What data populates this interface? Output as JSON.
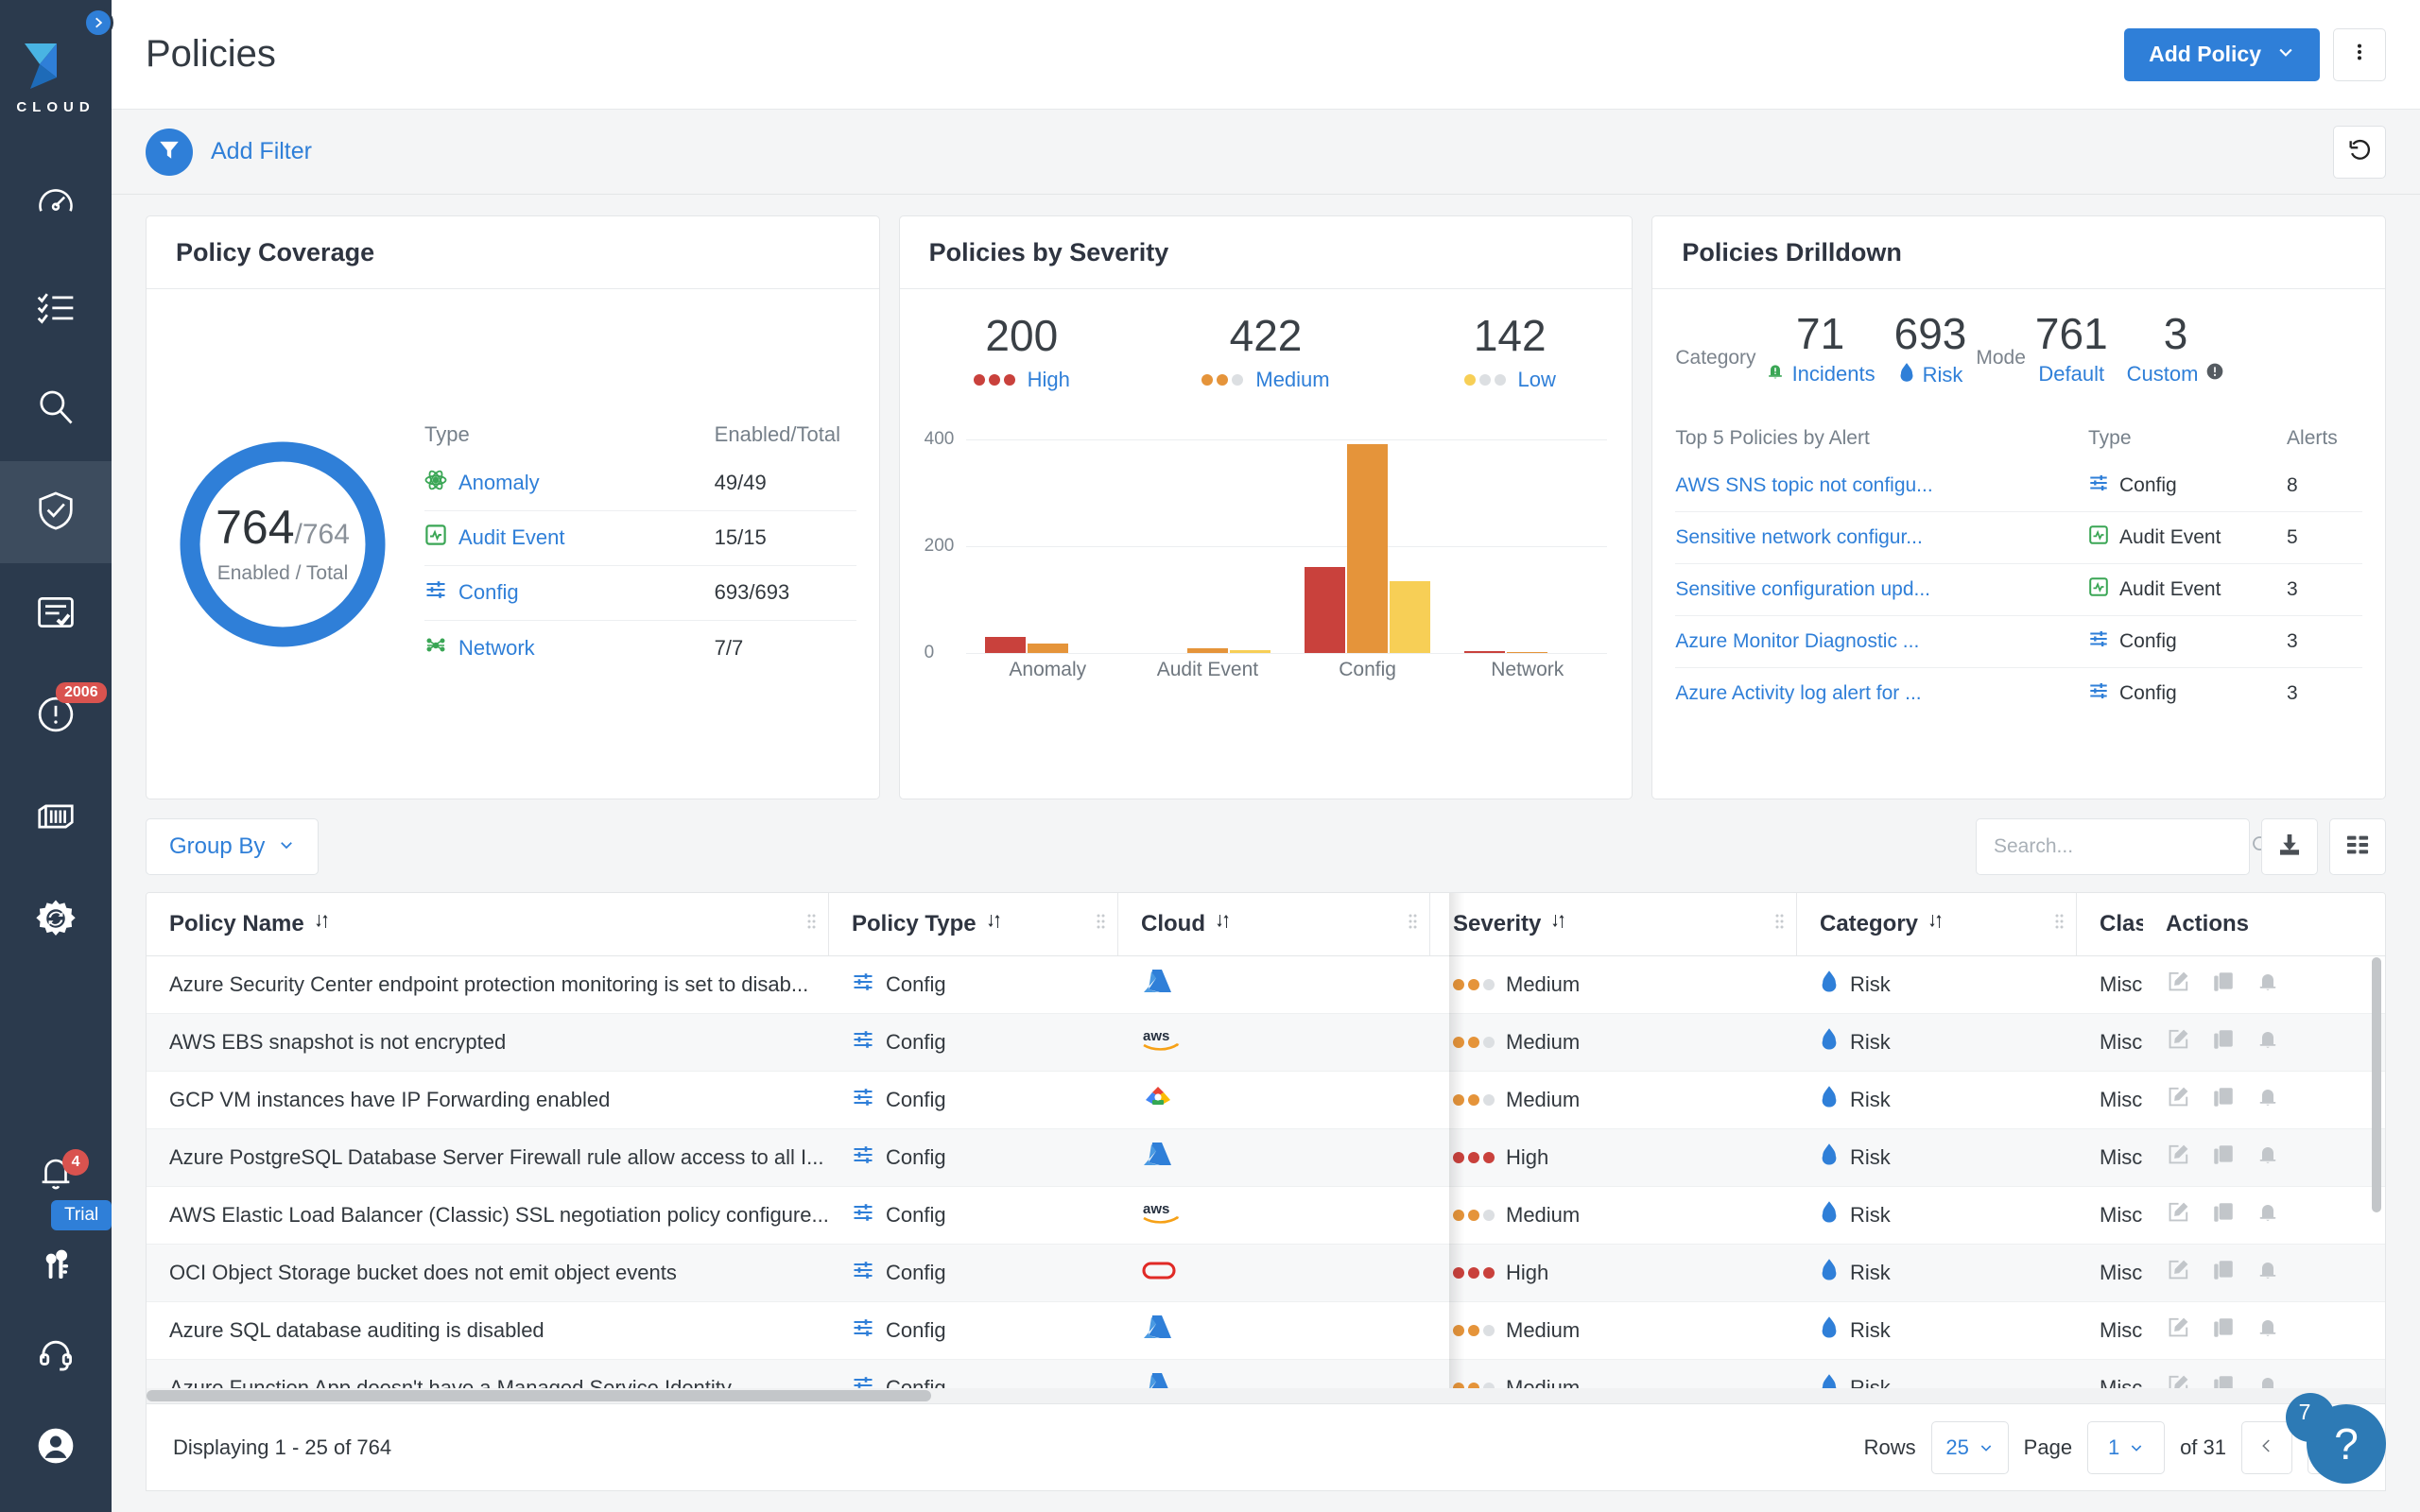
{
  "sidebar": {
    "logo_text": "CLOUD",
    "toggle_icon": "chevron-right-icon",
    "items": [
      {
        "name": "dashboard",
        "icon": "gauge-icon"
      },
      {
        "name": "investigate",
        "icon": "checklist-icon"
      },
      {
        "name": "search",
        "icon": "magnifier-icon"
      },
      {
        "name": "policies",
        "icon": "shield-check-icon",
        "active": true
      },
      {
        "name": "compliance",
        "icon": "document-check-icon"
      },
      {
        "name": "alerts",
        "icon": "exclamation-circle-icon",
        "badge": "2006"
      },
      {
        "name": "containers",
        "icon": "container-icon"
      },
      {
        "name": "settings",
        "icon": "gear-refresh-icon"
      }
    ],
    "bottom_items": [
      {
        "name": "notifications",
        "icon": "bell-icon",
        "badge": "4"
      },
      {
        "name": "licensing",
        "icon": "keys-icon",
        "tag": "Trial"
      },
      {
        "name": "support",
        "icon": "headset-icon"
      },
      {
        "name": "profile",
        "icon": "user-circle-icon"
      }
    ]
  },
  "topbar": {
    "title": "Policies",
    "add_policy_label": "Add Policy",
    "add_policy_caret": "chevron-down-icon",
    "more_icon": "kebab-menu-icon"
  },
  "filterbar": {
    "filter_icon": "funnel-icon",
    "add_filter_label": "Add Filter",
    "reset_icon": "undo-icon"
  },
  "coverage": {
    "title": "Policy Coverage",
    "donut_value": "764",
    "donut_total": "/764",
    "donut_caption": "Enabled / Total",
    "donut_color": "#2f7fd8",
    "col_type": "Type",
    "col_enabled": "Enabled/Total",
    "rows": [
      {
        "type": "Anomaly",
        "icon": "anomaly-icon",
        "value": "49/49"
      },
      {
        "type": "Audit Event",
        "icon": "audit-event-icon",
        "value": "15/15"
      },
      {
        "type": "Config",
        "icon": "config-icon",
        "value": "693/693"
      },
      {
        "type": "Network",
        "icon": "network-icon",
        "value": "7/7"
      }
    ]
  },
  "severity": {
    "title": "Policies by Severity",
    "summary": [
      {
        "count": "200",
        "label": "High",
        "filled": 3,
        "color": "#c9413c"
      },
      {
        "count": "422",
        "label": "Medium",
        "filled": 2,
        "color": "#e5943a"
      },
      {
        "count": "142",
        "label": "Low",
        "filled": 1,
        "color": "#f7cf56"
      }
    ]
  },
  "chart_data": {
    "type": "bar",
    "title": "Policies by Severity",
    "categories": [
      "Anomaly",
      "Audit Event",
      "Config",
      "Network"
    ],
    "series": [
      {
        "name": "High",
        "color": "#c9413c",
        "values": [
          29,
          0,
          161,
          3
        ]
      },
      {
        "name": "Medium",
        "color": "#e5943a",
        "values": [
          17,
          8,
          392,
          1
        ]
      },
      {
        "name": "Low",
        "color": "#f7cf56",
        "values": [
          0,
          5,
          135,
          0
        ]
      }
    ],
    "ylim": [
      0,
      440
    ],
    "yticks": [
      0,
      200,
      400
    ],
    "ytick_labels": [
      "0",
      "200",
      "400"
    ],
    "xlabel": "",
    "ylabel": "",
    "grid": true,
    "legend": "top"
  },
  "drilldown": {
    "title": "Policies Drilldown",
    "category_label": "Category",
    "mode_label": "Mode",
    "stats": [
      {
        "num": "71",
        "cap": "Incidents",
        "icon": "incident-bell-icon"
      },
      {
        "num": "693",
        "cap": "Risk",
        "icon": "risk-flame-icon"
      },
      {
        "num": "761",
        "cap": "Default",
        "icon": ""
      },
      {
        "num": "3",
        "cap": "Custom",
        "icon": "info-icon"
      }
    ],
    "col_policy": "Top 5 Policies by Alert",
    "col_type": "Type",
    "col_alerts": "Alerts",
    "rows": [
      {
        "policy": "AWS SNS topic not configu...",
        "type": "Config",
        "type_icon": "config-icon",
        "alerts": "8"
      },
      {
        "policy": "Sensitive network configur...",
        "type": "Audit Event",
        "type_icon": "audit-event-icon",
        "alerts": "5"
      },
      {
        "policy": "Sensitive configuration upd...",
        "type": "Audit Event",
        "type_icon": "audit-event-icon",
        "alerts": "3"
      },
      {
        "policy": "Azure Monitor Diagnostic ...",
        "type": "Config",
        "type_icon": "config-icon",
        "alerts": "3"
      },
      {
        "policy": "Azure Activity log alert for ...",
        "type": "Config",
        "type_icon": "config-icon",
        "alerts": "3"
      }
    ]
  },
  "tabletoolbar": {
    "group_by_label": "Group By",
    "group_by_caret": "chevron-down-icon",
    "search_placeholder": "Search...",
    "search_value": "",
    "search_icon": "magnifier-icon",
    "download_icon": "download-icon",
    "columns_icon": "columns-settings-icon"
  },
  "table": {
    "columns": [
      {
        "label": "Policy Name",
        "sort_icon": "sort-icon"
      },
      {
        "label": "Policy Type",
        "sort_icon": "sort-icon"
      },
      {
        "label": "Cloud",
        "sort_icon": "sort-icon"
      },
      {
        "label": "Severity",
        "sort_icon": "sort-icon"
      },
      {
        "label": "Category",
        "sort_icon": "sort-icon"
      },
      {
        "label": "Class",
        "sort_icon": ""
      },
      {
        "label": "Actions",
        "sort_icon": ""
      }
    ],
    "row_action_icons": [
      "edit-icon",
      "copy-icon",
      "bell-icon"
    ],
    "rows": [
      {
        "name": "Azure Security Center endpoint protection monitoring is set to disab...",
        "policy_type": "Config",
        "cloud": "azure",
        "severity": "Medium",
        "sev_filled": 2,
        "category": "Risk",
        "class": "Misc"
      },
      {
        "name": "AWS EBS snapshot is not encrypted",
        "policy_type": "Config",
        "cloud": "aws",
        "severity": "Medium",
        "sev_filled": 2,
        "category": "Risk",
        "class": "Misc"
      },
      {
        "name": "GCP VM instances have IP Forwarding enabled",
        "policy_type": "Config",
        "cloud": "gcp",
        "severity": "Medium",
        "sev_filled": 2,
        "category": "Risk",
        "class": "Misc"
      },
      {
        "name": "Azure PostgreSQL Database Server Firewall rule allow access to all I...",
        "policy_type": "Config",
        "cloud": "azure",
        "severity": "High",
        "sev_filled": 3,
        "category": "Risk",
        "class": "Misc"
      },
      {
        "name": "AWS Elastic Load Balancer (Classic) SSL negotiation policy configure...",
        "policy_type": "Config",
        "cloud": "aws",
        "severity": "Medium",
        "sev_filled": 2,
        "category": "Risk",
        "class": "Misc"
      },
      {
        "name": "OCI Object Storage bucket does not emit object events",
        "policy_type": "Config",
        "cloud": "oracle",
        "severity": "High",
        "sev_filled": 3,
        "category": "Risk",
        "class": "Misc"
      },
      {
        "name": "Azure SQL database auditing is disabled",
        "policy_type": "Config",
        "cloud": "azure",
        "severity": "Medium",
        "sev_filled": 2,
        "category": "Risk",
        "class": "Misc"
      },
      {
        "name": "Azure Function App doesn't have a Managed Service Identity",
        "policy_type": "Config",
        "cloud": "azure",
        "severity": "Medium",
        "sev_filled": 2,
        "category": "Risk",
        "class": "Misc"
      }
    ]
  },
  "footer": {
    "displaying": "Displaying 1 - 25 of 764",
    "rows_label": "Rows",
    "rows_value": "25",
    "page_label": "Page",
    "page_value": "1",
    "of_label": "of 31",
    "prev_icon": "chevron-left-icon",
    "next_icon": "chevron-right-icon"
  },
  "help": {
    "icon": "question-mark-icon",
    "count": "7"
  },
  "colors": {
    "accent": "#2f7fd8",
    "sidebar": "#2b3a4d",
    "high": "#c9413c",
    "medium": "#e5943a",
    "low": "#f7cf56",
    "badge_red": "#d9534f"
  }
}
